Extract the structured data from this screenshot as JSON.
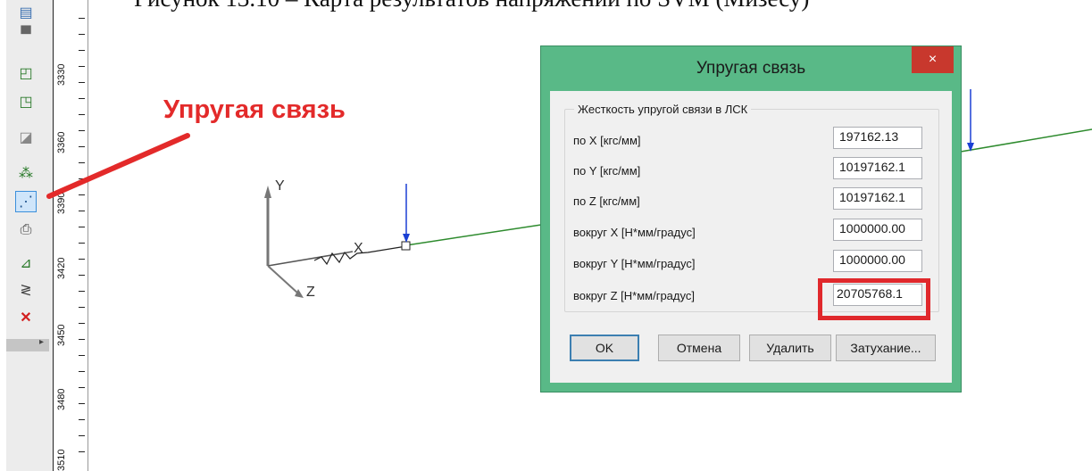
{
  "caption": "Рисунок 13.10 – Карта результатов напряжений по SVM (Мизесу)",
  "annotation": "Упругая связь",
  "toolbar": {
    "icons": [
      "table-icon",
      "cube-icon",
      "cube-plus-icon",
      "support-icon",
      "nodes-grid-icon",
      "spring-icon",
      "printer-icon",
      "plane-icon",
      "zigzag-icon",
      "delete-icon"
    ],
    "selected_icon": "spring-icon",
    "expand_glyph": "▸"
  },
  "ruler": {
    "labels": [
      "3330",
      "3360",
      "3390",
      "3420",
      "3450",
      "3480",
      "3510"
    ]
  },
  "scene": {
    "axes": {
      "x_label": "X",
      "y_label": "Y",
      "z_label": "Z"
    },
    "colors": {
      "beam": "#2e8b2e",
      "load": "#1a3fd4",
      "axis": "#555555",
      "line": "#000000"
    }
  },
  "dialog": {
    "title": "Упругая связь",
    "close_label": "×",
    "group_title": "Жесткость упругой связи в ЛСК",
    "fields": [
      {
        "label": "по X [кгс/мм]",
        "value": "197162.13"
      },
      {
        "label": "по Y [кгс/мм]",
        "value": "10197162.1"
      },
      {
        "label": "по Z [кгс/мм]",
        "value": "10197162.1"
      },
      {
        "label": "вокруг X [Н*мм/градус]",
        "value": "1000000.00"
      },
      {
        "label": "вокруг Y [Н*мм/градус]",
        "value": "1000000.00"
      },
      {
        "label": "вокруг Z [Н*мм/градус]",
        "value": "20705768.1"
      }
    ],
    "buttons": {
      "ok": "OK",
      "cancel": "Отмена",
      "delete": "Удалить",
      "damping": "Затухание..."
    }
  }
}
